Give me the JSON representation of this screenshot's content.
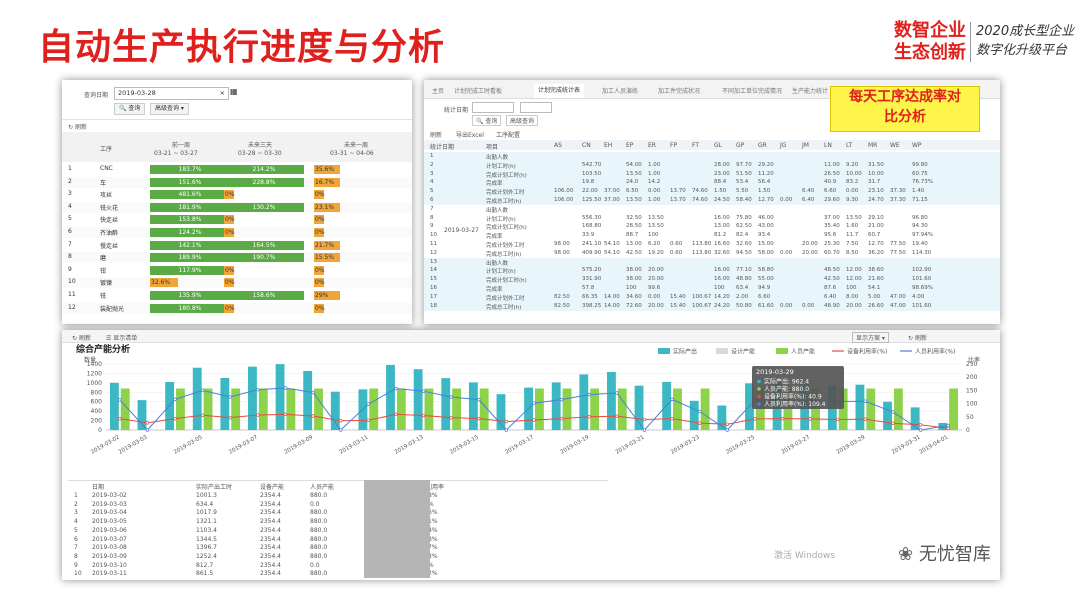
{
  "slide": {
    "title": "自动生产执行进度与分析",
    "logo_main_line1": "数智企业",
    "logo_main_line2": "生态创新",
    "logo_sub_line1": "2020成长型企业",
    "logo_sub_line2": "数字化升级平台",
    "callout_line1": "每天工序达成率对",
    "callout_line2": "比分析",
    "brand_watermark": "无忧智库",
    "windows_watermark": "激活 Windows"
  },
  "panel1": {
    "query_label": "查询日期",
    "query_date": "2019-03-28",
    "query_button": "查询",
    "advanced_button": "高级查询",
    "refresh_label": "刷新",
    "col_process": "工序",
    "col_prev_week": "前一周",
    "col_prev_range": "03-21 ~ 03-27",
    "col_next3": "未来三天",
    "col_next3_range": "03-28 ~ 03-30",
    "col_next_week": "未来一周",
    "col_next_week_range": "03-31 ~ 04-06",
    "rows": [
      {
        "n": "1",
        "name": "CNC",
        "a": "183.7%",
        "b": "214.2%",
        "c": "35.6%"
      },
      {
        "n": "2",
        "name": "车",
        "a": "151.6%",
        "b": "228.8%",
        "c": "16.7%"
      },
      {
        "n": "3",
        "name": "攻丝",
        "a": "481.6%",
        "b": "0%",
        "c": "0%"
      },
      {
        "n": "4",
        "name": "铣火花",
        "a": "181.9%",
        "b": "130.2%",
        "c": "23.1%"
      },
      {
        "n": "5",
        "name": "快走丝",
        "a": "153.8%",
        "b": "0%",
        "c": "0%"
      },
      {
        "n": "6",
        "name": "齐油酔",
        "a": "124.2%",
        "b": "0%",
        "c": "0%"
      },
      {
        "n": "7",
        "name": "慢走丝",
        "a": "142.1%",
        "b": "164.5%",
        "c": "21.7%"
      },
      {
        "n": "8",
        "name": "磨",
        "a": "189.9%",
        "b": "190.7%",
        "c": "15.5%"
      },
      {
        "n": "9",
        "name": "钳",
        "a": "117.9%",
        "b": "0%",
        "c": "0%"
      },
      {
        "n": "10",
        "name": "镀镍",
        "a": "32.6%",
        "b": "0%",
        "c": "0%"
      },
      {
        "n": "11",
        "name": "铣",
        "a": "135.9%",
        "b": "158.6%",
        "c": "29%"
      },
      {
        "n": "12",
        "name": "装配抛光",
        "a": "180.8%",
        "b": "0%",
        "c": "0%"
      }
    ]
  },
  "panel2": {
    "tabs": [
      "主页",
      "计划完成工时看板",
      "计划完成统计表",
      "加工人员演练",
      "加工件完成状况",
      "不同加工单位完成情况",
      "生产能力统计"
    ],
    "date_label": "统计日期",
    "query_button": "查询",
    "advanced_button": "高级查询",
    "toolbar": [
      "刷新",
      "导出Excel",
      "工序配置"
    ],
    "headers": [
      "统计日期",
      "项目",
      "AS",
      "CN",
      "EH",
      "EP",
      "ER",
      "FP",
      "FT",
      "GL",
      "GP",
      "GR",
      "JG",
      "JM",
      "LN",
      "LT",
      "MR",
      "WE",
      "WP"
    ],
    "groups": [
      {
        "date": "2019-03-26",
        "rows": [
          [
            "1",
            "出勤人数",
            "",
            "",
            "",
            "",
            "",
            "",
            "",
            "",
            "",
            "",
            "",
            "",
            "",
            "",
            "",
            "",
            ""
          ],
          [
            "2",
            "计划工时(h)",
            "",
            "542.70",
            "",
            "54.00",
            "1.00",
            "",
            "",
            "28.00",
            "97.70",
            "29.20",
            "",
            "",
            "11.00",
            "9.20",
            "31.50",
            "",
            "99.80"
          ],
          [
            "3",
            "完成计划工时(h)",
            "",
            "103.50",
            "",
            "13.50",
            "1.00",
            "",
            "",
            "23.00",
            "51.50",
            "11.20",
            "",
            "",
            "26.50",
            "10.00",
            "10.00",
            "",
            "60.75"
          ],
          [
            "4",
            "完成率",
            "",
            "19.8",
            "",
            "24.0",
            "14.2",
            "",
            "",
            "88.4",
            "53.4",
            "56.4",
            "",
            "",
            "40.9",
            "83.2",
            "31.7",
            "",
            "76.73%"
          ],
          [
            "5",
            "完成计划外工时",
            "106.00",
            "22.00",
            "37.00",
            "6.50",
            "0.00",
            "13.70",
            "74.60",
            "1.50",
            "5.50",
            "1.50",
            "",
            "6.40",
            "6.60",
            "0.00",
            "23.10",
            "37.30",
            "1.40"
          ],
          [
            "6",
            "完成总工时(h)",
            "106.00",
            "125.50",
            "37.00",
            "13.50",
            "1.00",
            "13.70",
            "74.60",
            "24.50",
            "58.40",
            "12.70",
            "0.00",
            "6.40",
            "29.60",
            "9.30",
            "24.70",
            "37.30",
            "71.15"
          ]
        ]
      },
      {
        "date": "2019-03-27",
        "rows": [
          [
            "7",
            "出勤人数",
            "",
            "",
            "",
            "",
            "",
            "",
            "",
            "",
            "",
            "",
            "",
            "",
            "",
            "",
            "",
            "",
            ""
          ],
          [
            "8",
            "计划工时(h)",
            "",
            "556.30",
            "",
            "32.50",
            "13.50",
            "",
            "",
            "16.00",
            "75.80",
            "46.00",
            "",
            "",
            "37.00",
            "13.50",
            "29.10",
            "",
            "96.80"
          ],
          [
            "9",
            "完成计划工时(h)",
            "",
            "168.80",
            "",
            "28.50",
            "13.50",
            "",
            "",
            "13.00",
            "62.50",
            "43.00",
            "",
            "",
            "35.40",
            "1.60",
            "21.00",
            "",
            "94.30"
          ],
          [
            "10",
            "完成率",
            "",
            "33.9",
            "",
            "88.7",
            "100",
            "",
            "",
            "81.2",
            "82.4",
            "93.4",
            "",
            "",
            "95.6",
            "11.7",
            "60.7",
            "",
            "97.94%"
          ],
          [
            "11",
            "完成计划外工时",
            "98.00",
            "241.10",
            "54.10",
            "13.00",
            "6.20",
            "0.60",
            "113.80",
            "16.60",
            "32.60",
            "15.00",
            "",
            "20.00",
            "25.30",
            "7.50",
            "12.70",
            "77.50",
            "19.40"
          ],
          [
            "12",
            "完成总工时(h)",
            "98.00",
            "409.90",
            "54.10",
            "42.50",
            "19.20",
            "0.60",
            "113.80",
            "32.60",
            "94.50",
            "58.00",
            "0.00",
            "20.00",
            "60.70",
            "8.50",
            "36.20",
            "77.50",
            "114.30"
          ]
        ]
      },
      {
        "date": "2019-03-28",
        "rows": [
          [
            "13",
            "出勤人数",
            "",
            "",
            "",
            "",
            "",
            "",
            "",
            "",
            "",
            "",
            "",
            "",
            "",
            "",
            "",
            "",
            ""
          ],
          [
            "14",
            "计划工时(h)",
            "",
            "575.20",
            "",
            "38.00",
            "20.00",
            "",
            "",
            "16.00",
            "77.10",
            "58.80",
            "",
            "",
            "48.50",
            "12.00",
            "38.60",
            "",
            "102.90"
          ],
          [
            "15",
            "完成计划工时(h)",
            "",
            "331.90",
            "",
            "38.00",
            "20.00",
            "",
            "",
            "16.00",
            "48.80",
            "55.00",
            "",
            "",
            "42.50",
            "12.00",
            "21.60",
            "",
            "101.60"
          ],
          [
            "16",
            "完成率",
            "",
            "57.8",
            "",
            "100",
            "99.6",
            "",
            "",
            "100",
            "63.4",
            "94.9",
            "",
            "",
            "87.6",
            "100",
            "54.1",
            "",
            "98.69%"
          ],
          [
            "17",
            "完成计划外工时",
            "82.50",
            "66.35",
            "14.00",
            "34.60",
            "0.00",
            "15.40",
            "100.67",
            "14.20",
            "2.00",
            "6.60",
            "",
            "",
            "6.40",
            "8.00",
            "5.00",
            "47.00",
            "4.00"
          ],
          [
            "18",
            "完成总工时(h)",
            "82.50",
            "398.25",
            "14.00",
            "72.60",
            "20.00",
            "15.40",
            "100.67",
            "24.20",
            "50.80",
            "61.60",
            "0.00",
            "0.00",
            "48.90",
            "20.00",
            "26.60",
            "47.00",
            "101.60"
          ]
        ]
      }
    ]
  },
  "panel3": {
    "toolbar_refresh": "刷新",
    "toolbar_show": "显示清单",
    "toolbar_dropdown": "显示方案",
    "toolbar_refresh2": "刷新",
    "chart_title": "综合产能分析",
    "left_axis_label": "数量",
    "right_axis_label": "比率",
    "legend": [
      "实际产出",
      "设计产能",
      "人员产能",
      "设备利用率(%)",
      "人员利用率(%)"
    ],
    "tooltip": {
      "date": "2019-03-29",
      "l1": "实际产出: 962.4",
      "l2": "人员产能: 880.0",
      "l3": "设备利用率(%): 40.9",
      "l4": "人员利用率(%): 109.4"
    },
    "table_headers": [
      "日期",
      "实际产出工时",
      "设备产能",
      "人员产能",
      "设备利用率",
      "人员利用率"
    ],
    "table_rows": [
      [
        "1",
        "2019-03-02",
        "1001.3",
        "2354.4",
        "880.0",
        "",
        "8%"
      ],
      [
        "2",
        "2019-03-03",
        "634.4",
        "2354.4",
        "0.0",
        "",
        "%"
      ],
      [
        "3",
        "2019-03-04",
        "1017.9",
        "2354.4",
        "880.0",
        "",
        "6%"
      ],
      [
        "4",
        "2019-03-05",
        "1321.1",
        "2354.4",
        "880.0",
        "",
        "1%"
      ],
      [
        "5",
        "2019-03-06",
        "1103.4",
        "2354.4",
        "880.0",
        "",
        "4%"
      ],
      [
        "6",
        "2019-03-07",
        "1344.5",
        "2354.4",
        "880.0",
        "",
        "8%"
      ],
      [
        "7",
        "2019-03-08",
        "1396.7",
        "2354.4",
        "880.0",
        "",
        "7%"
      ],
      [
        "8",
        "2019-03-09",
        "1252.4",
        "2354.4",
        "880.0",
        "",
        "3%"
      ],
      [
        "9",
        "2019-03-10",
        "812.7",
        "2354.4",
        "0.0",
        "",
        "%"
      ],
      [
        "10",
        "2019-03-11",
        "861.5",
        "2354.4",
        "880.0",
        "",
        "2%"
      ]
    ]
  },
  "chart_data": {
    "type": "bar",
    "title": "综合产能分析",
    "ylabel": "数量",
    "y2label": "比率",
    "ylim": [
      0,
      1400
    ],
    "y2lim": [
      0,
      250
    ],
    "yticks": [
      0,
      200,
      400,
      600,
      800,
      1000,
      1200,
      1400
    ],
    "y2ticks": [
      0,
      50,
      100,
      150,
      200,
      250
    ],
    "legend_position": "top-right",
    "categories": [
      "2019-03-02",
      "2019-03-03",
      "2019-03-04",
      "2019-03-05",
      "2019-03-06",
      "2019-03-07",
      "2019-03-08",
      "2019-03-09",
      "2019-03-10",
      "2019-03-11",
      "2019-03-12",
      "2019-03-13",
      "2019-03-14",
      "2019-03-15",
      "2019-03-16",
      "2019-03-17",
      "2019-03-18",
      "2019-03-19",
      "2019-03-20",
      "2019-03-21",
      "2019-03-22",
      "2019-03-23",
      "2019-03-24",
      "2019-03-25",
      "2019-03-26",
      "2019-03-27",
      "2019-03-28",
      "2019-03-29",
      "2019-03-30",
      "2019-03-31",
      "2019-04-01"
    ],
    "xtick_labels": [
      "2019-03-02",
      "2019-03-03",
      "2019-03-05",
      "2019-03-07",
      "2019-03-09",
      "2019-03-11",
      "2019-03-13",
      "2019-03-15",
      "2019-03-17",
      "2019-03-19",
      "2019-03-21",
      "2019-03-23",
      "2019-03-25",
      "2019-03-27",
      "2019-03-29",
      "2019-03-31",
      "2019-04-01"
    ],
    "series": [
      {
        "name": "实际产出",
        "axis": "left",
        "color": "#3bb8c3",
        "values": [
          1001,
          634,
          1018,
          1321,
          1103,
          1344,
          1397,
          1252,
          813,
          862,
          1380,
          1290,
          1100,
          1010,
          760,
          900,
          1010,
          1180,
          1230,
          940,
          1020,
          620,
          520,
          990,
          1015,
          980,
          950,
          962,
          600,
          480,
          150
        ]
      },
      {
        "name": "人员产能",
        "axis": "left",
        "color": "#8ed14b",
        "values": [
          880,
          0,
          880,
          880,
          880,
          880,
          880,
          880,
          0,
          880,
          880,
          880,
          880,
          880,
          0,
          880,
          880,
          880,
          880,
          0,
          880,
          880,
          0,
          880,
          880,
          880,
          880,
          880,
          880,
          0,
          880
        ]
      },
      {
        "name": "设备利用率(%)",
        "axis": "right",
        "color": "#e84c3d",
        "values": [
          43,
          27,
          43,
          56,
          47,
          57,
          59,
          53,
          35,
          37,
          59,
          55,
          47,
          43,
          32,
          38,
          43,
          50,
          52,
          40,
          43,
          26,
          22,
          42,
          43,
          42,
          40,
          41,
          25,
          20,
          6
        ]
      },
      {
        "name": "人员利用率(%)",
        "axis": "right",
        "color": "#4a7fd6",
        "values": [
          114,
          0,
          116,
          150,
          125,
          153,
          159,
          142,
          0,
          98,
          157,
          147,
          125,
          115,
          0,
          102,
          115,
          134,
          140,
          0,
          116,
          70,
          0,
          113,
          115,
          111,
          108,
          109,
          68,
          0,
          17
        ]
      }
    ]
  }
}
